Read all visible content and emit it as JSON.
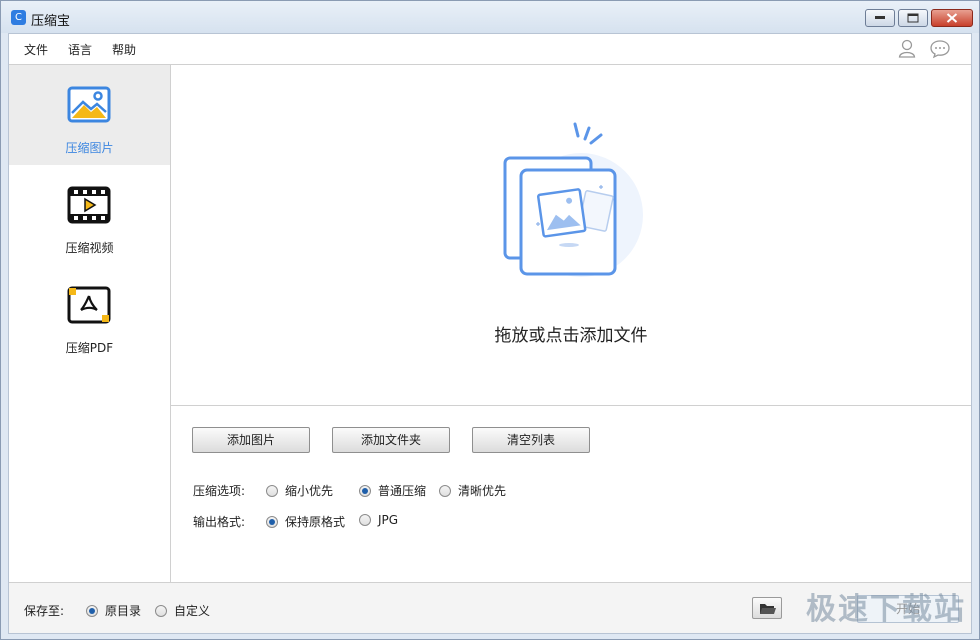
{
  "window": {
    "title": "压缩宝"
  },
  "menu": {
    "file": "文件",
    "language": "语言",
    "help": "帮助"
  },
  "sidebar": {
    "items": [
      {
        "label": "压缩图片",
        "icon": "image-icon",
        "active": true
      },
      {
        "label": "压缩视频",
        "icon": "video-icon",
        "active": false
      },
      {
        "label": "压缩PDF",
        "icon": "pdf-icon",
        "active": false
      }
    ]
  },
  "dropzone": {
    "text": "拖放或点击添加文件"
  },
  "buttons": {
    "add_image": "添加图片",
    "add_folder": "添加文件夹",
    "clear_list": "清空列表"
  },
  "compress_options": {
    "label": "压缩选项:",
    "options": [
      "缩小优先",
      "普通压缩",
      "清晰优先"
    ],
    "selected": "普通压缩"
  },
  "output_format": {
    "label": "输出格式:",
    "options": [
      "保持原格式",
      "JPG"
    ],
    "selected": "保持原格式"
  },
  "save_to": {
    "label": "保存至:",
    "options": [
      "原目录",
      "自定义"
    ],
    "selected": "原目录"
  },
  "start_button": "开始",
  "watermark": "极速下载站",
  "colors": {
    "accent": "#3c86e0",
    "titlebar": "#dfe8f3"
  }
}
